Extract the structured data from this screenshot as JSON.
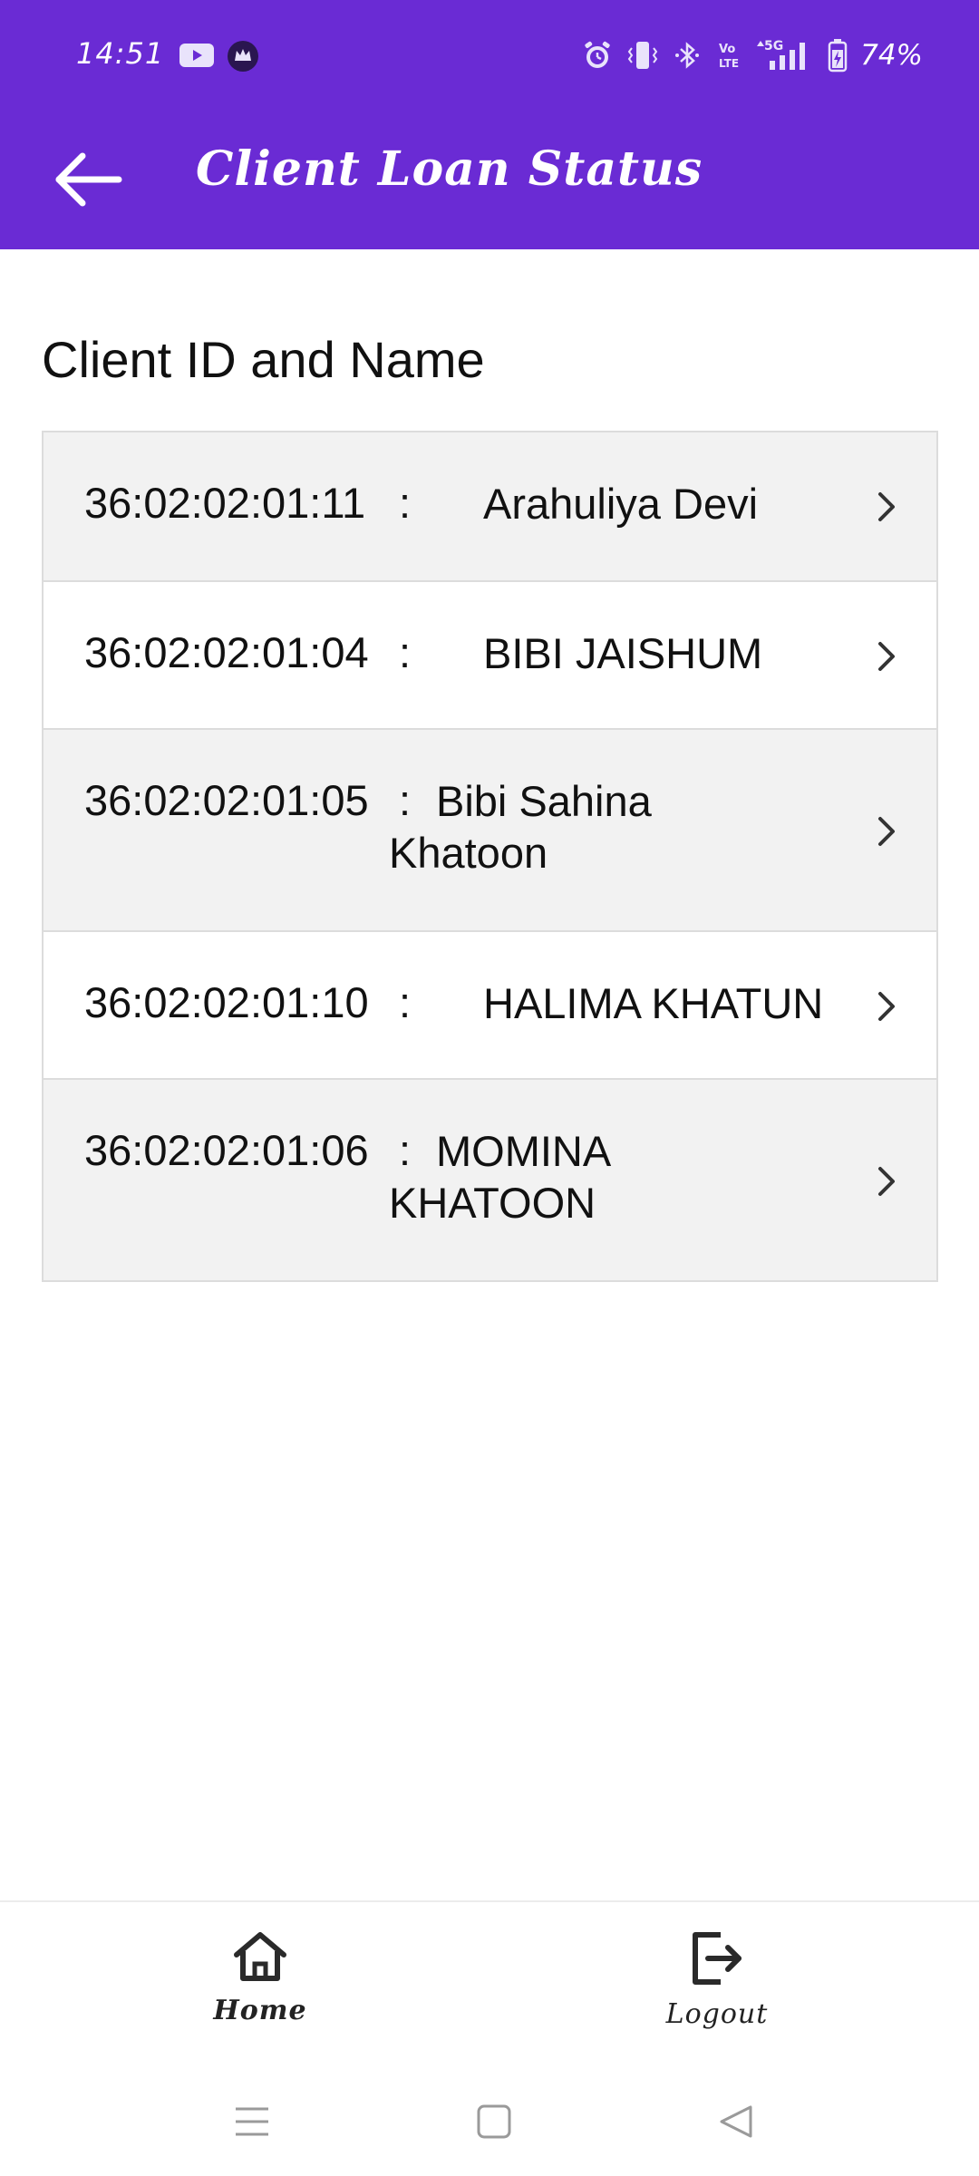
{
  "status_bar": {
    "time": "14:51",
    "battery": "74%",
    "icons": [
      "youtube-icon",
      "crown-app-icon",
      "alarm-icon",
      "vibrate-icon",
      "bluetooth-icon",
      "volte-icon",
      "signal-5g-icon",
      "battery-charging-icon"
    ],
    "network_label": "5G",
    "volte_label": "Vo LTE"
  },
  "app_bar": {
    "title": "Client Loan Status",
    "back_icon": "arrow-left-icon"
  },
  "section_title": "Client ID and Name",
  "clients": [
    {
      "id": "36:02:02:01:11",
      "separator": ":",
      "name": "Arahuliya Devi"
    },
    {
      "id": "36:02:02:01:04",
      "separator": ":",
      "name": "BIBI JAISHUM"
    },
    {
      "id": "36:02:02:01:05",
      "separator": ":",
      "name": "Bibi Sahina Khatoon"
    },
    {
      "id": "36:02:02:01:10",
      "separator": ":",
      "name": "HALIMA KHATUN"
    },
    {
      "id": "36:02:02:01:06",
      "separator": ":",
      "name": "MOMINA KHATOON"
    }
  ],
  "bottom_nav": {
    "home_label": "Home",
    "logout_label": "Logout"
  },
  "colors": {
    "primary": "#6a2bd4",
    "row_shaded": "#f2f2f2",
    "row_border": "#dcdcdc"
  }
}
